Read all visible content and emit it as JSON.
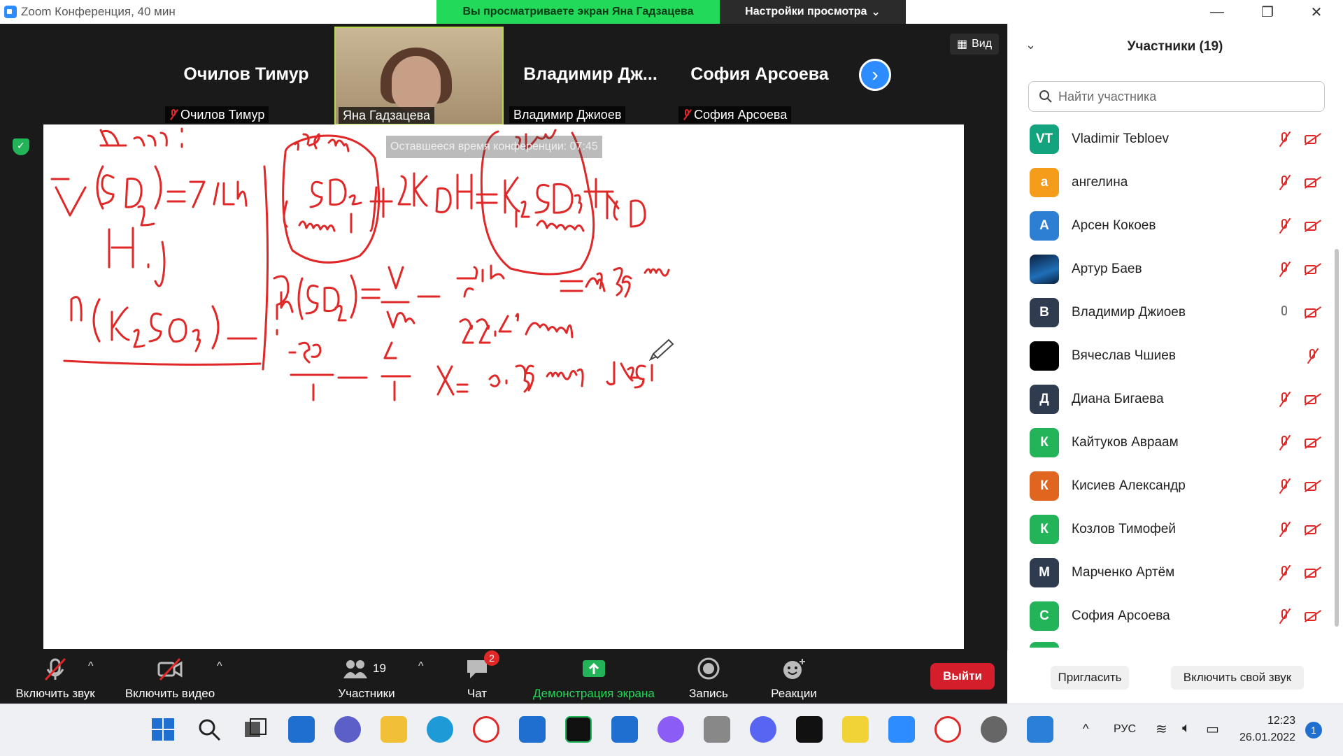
{
  "window": {
    "title": "Zoom Конференция, 40 мин",
    "share_banner": "Вы просматриваете экран Яна Гадзацева",
    "view_options": "Настройки просмотра",
    "minimize": "—",
    "maximize": "❐",
    "close": "✕"
  },
  "gallery": {
    "tiles": [
      {
        "display": "Очилов Тимур",
        "label": "Очилов Тимур"
      },
      {
        "display": "",
        "label": "Яна Гадзацева"
      },
      {
        "display": "Владимир Дж...",
        "label": "Владимир Джиоев"
      },
      {
        "display": "София Арсоева",
        "label": "София Арсоева"
      }
    ],
    "next_label": "›",
    "view_button": "Вид"
  },
  "timer": "Оставшееся время конференции: 07:45",
  "toolbar": {
    "audio": "Включить звук",
    "video": "Включить видео",
    "participants": "Участники",
    "participants_count": "19",
    "chat": "Чат",
    "chat_badge": "2",
    "share": "Демонстрация экрана",
    "record": "Запись",
    "reactions": "Реакции",
    "leave": "Выйти",
    "caret": "^"
  },
  "panel": {
    "title": "Участники (19)",
    "collapse": "⌄",
    "search_placeholder": "Найти участника",
    "participants": [
      {
        "initials": "VT",
        "name": "Vladimir Tebloev",
        "color": "#13a37f",
        "mic": "off",
        "cam": "off"
      },
      {
        "initials": "а",
        "name": "ангелина",
        "color": "#f59c1a",
        "mic": "off",
        "cam": "off"
      },
      {
        "initials": "А",
        "name": "Арсен Кокоев",
        "color": "#2d7fd3",
        "mic": "off",
        "cam": "off"
      },
      {
        "initials": "",
        "name": "Артур Баев",
        "color": "#0b2a55",
        "mic": "off",
        "cam": "off"
      },
      {
        "initials": "В",
        "name": "Владимир Джиоев",
        "color": "#2f3b4f",
        "mic": "on",
        "cam": "off"
      },
      {
        "initials": "",
        "name": "Вячеслав Чшиев",
        "color": "#000000",
        "mic": "off",
        "cam": "none"
      },
      {
        "initials": "Д",
        "name": "Диана Бигаева",
        "color": "#2f3b4f",
        "mic": "off",
        "cam": "off"
      },
      {
        "initials": "К",
        "name": "Кайтуков Авраам",
        "color": "#23b358",
        "mic": "off",
        "cam": "off"
      },
      {
        "initials": "К",
        "name": "Кисиев Александр",
        "color": "#e0661f",
        "mic": "off",
        "cam": "off"
      },
      {
        "initials": "К",
        "name": "Козлов Тимофей",
        "color": "#23b358",
        "mic": "off",
        "cam": "off"
      },
      {
        "initials": "М",
        "name": "Марченко Артём",
        "color": "#2f3b4f",
        "mic": "off",
        "cam": "off"
      },
      {
        "initials": "С",
        "name": "София Арсоева",
        "color": "#23b358",
        "mic": "off",
        "cam": "off"
      }
    ],
    "invite": "Пригласить",
    "unmute_self": "Включить свой звук"
  },
  "taskbar": {
    "language": "РУС",
    "time": "12:23",
    "date": "26.01.2022",
    "notifications": "1",
    "tray_caret": "^"
  },
  "colors": {
    "accent": "#2d8cff",
    "share_green": "#23d959",
    "leave_red": "#d51e2b",
    "ink": "#e02828"
  }
}
